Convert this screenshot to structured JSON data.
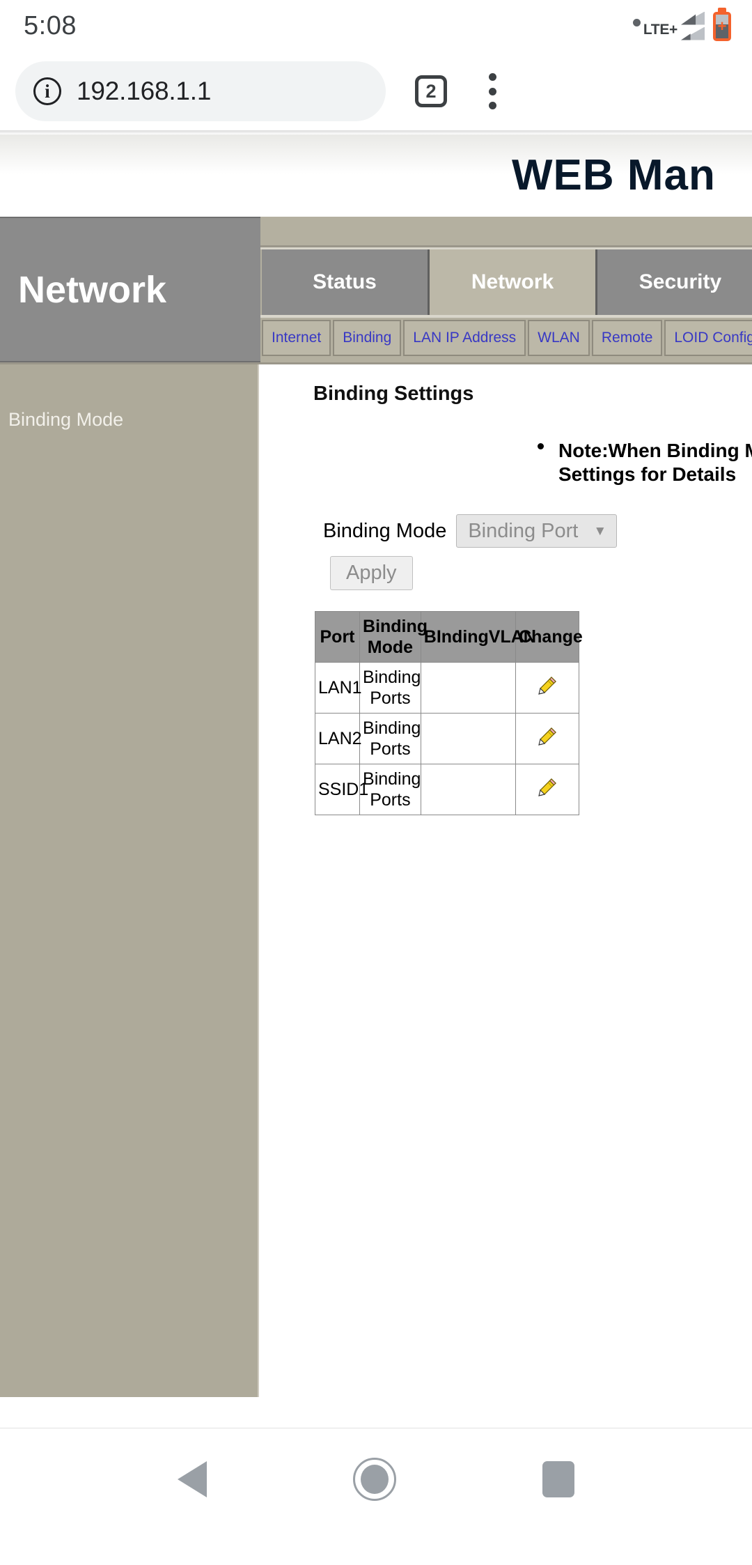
{
  "status_bar": {
    "clock": "5:08",
    "network_type": "LTE+",
    "icons": {
      "dot": "dot-icon",
      "signal1": "signal-bars-icon",
      "signal2": "signal-bars-secondary-icon",
      "battery": "battery-charging-icon"
    }
  },
  "browser": {
    "url": "192.168.1.1",
    "info_glyph": "i",
    "tab_count": "2",
    "info_icon_name": "page-info-icon",
    "tab_switcher_name": "tab-switcher-button",
    "menu_name": "browser-menu-button"
  },
  "page": {
    "title": "WEB  Man",
    "section_label": "Network",
    "main_tabs": [
      {
        "label": "Status",
        "active": false
      },
      {
        "label": "Network",
        "active": true
      },
      {
        "label": "Security",
        "active": false
      },
      {
        "label": "",
        "active": false
      }
    ],
    "sub_tabs": [
      {
        "label": "Internet"
      },
      {
        "label": "Binding"
      },
      {
        "label": "LAN IP Address"
      },
      {
        "label": "WLAN"
      },
      {
        "label": "Remote"
      },
      {
        "label": "LOID Configuration"
      },
      {
        "label": ""
      }
    ],
    "sidebar": {
      "items": [
        {
          "label": "Binding Mode"
        }
      ]
    },
    "content": {
      "heading": "Binding Settings",
      "note": "Note:When Binding Mode is Binding Ports, Pleas\nSettings for Details",
      "binding_mode_label": "Binding Mode",
      "binding_mode_value": "Binding Port",
      "binding_mode_arrow": "▼",
      "apply_label": "Apply",
      "table": {
        "headers": [
          "Port",
          "Binding Mode",
          "BIndingVLAN",
          "Change"
        ],
        "rows": [
          {
            "port": "LAN1",
            "mode": "Binding Ports",
            "vlan": "",
            "change_icon": "edit-pencil-icon"
          },
          {
            "port": "LAN2",
            "mode": "Binding Ports",
            "vlan": "",
            "change_icon": "edit-pencil-icon"
          },
          {
            "port": "SSID1",
            "mode": "Binding Ports",
            "vlan": "",
            "change_icon": "edit-pencil-icon"
          }
        ]
      }
    }
  },
  "android_nav": {
    "back": "back-button",
    "home": "home-button",
    "recents": "recents-button"
  },
  "colors": {
    "nav_grey": "#8b8b8b",
    "nav_tan": "#b4b0a0",
    "sidebar_tan": "#aeaa9a",
    "link_blue": "#3838c4",
    "battery_orange": "#f4622c",
    "table_header_grey": "#9a9a9a"
  }
}
